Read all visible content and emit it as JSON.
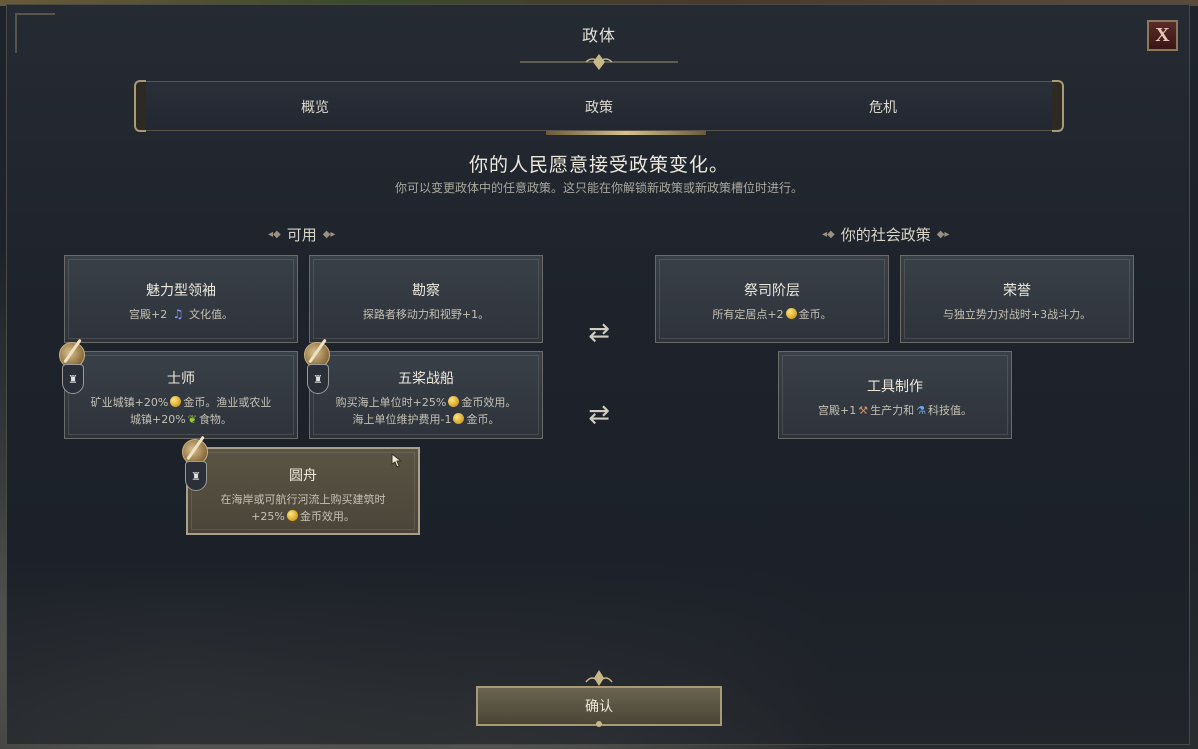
{
  "window": {
    "title": "政体",
    "close_label": "X"
  },
  "tabs": [
    {
      "label": "概览",
      "active": false
    },
    {
      "label": "政策",
      "active": true
    },
    {
      "label": "危机",
      "active": false
    }
  ],
  "headline": "你的人民愿意接受政策变化。",
  "subline": "你可以变更政体中的任意政策。这只能在你解锁新政策或新政策槽位时进行。",
  "available": {
    "title": "可用",
    "cards": [
      {
        "name": "魅力型领袖",
        "desc_lines": [
          "宫殿+2 {note} 文化值。"
        ],
        "parts": [
          "宫殿+2",
          "文化值。"
        ]
      },
      {
        "name": "勘察",
        "desc": "探路者移动力和视野+1。"
      },
      {
        "name": "士师",
        "desc_a": "矿业城镇+20%",
        "desc_b": "金币。渔业或农业",
        "desc_c": "城镇+20%",
        "desc_d": "食物。"
      },
      {
        "name": "五桨战船",
        "desc_a": "购买海上单位时+25%",
        "desc_b": "金币效用。",
        "desc_c": "海上单位维护费用-1",
        "desc_d": "金币。"
      },
      {
        "name": "圆舟",
        "desc_a": "在海岸或可航行河流上购买建筑时",
        "desc_b": "+25%",
        "desc_c": "金币效用。"
      }
    ]
  },
  "social": {
    "title": "你的社会政策",
    "cards": [
      {
        "name": "祭司阶层",
        "desc_a": "所有定居点+2",
        "desc_b": "金币。"
      },
      {
        "name": "荣誉",
        "desc": "与独立势力对战时+3战斗力。"
      },
      {
        "name": "工具制作",
        "desc_a": "宫殿+1",
        "desc_b": "生产力和",
        "desc_c": "科技值。"
      }
    ]
  },
  "confirm_label": "确认",
  "icons": {
    "swap": "swap-arrows-icon",
    "coin": "gold-coin-icon",
    "note": "culture-note-icon",
    "food": "food-icon",
    "production": "hammer-icon",
    "science": "flask-icon",
    "new_badge": "feather-quill-icon"
  },
  "colors": {
    "accent_gold": "#a89a74",
    "hover_card": "#5a5444",
    "close_red": "#5a2a2a"
  }
}
